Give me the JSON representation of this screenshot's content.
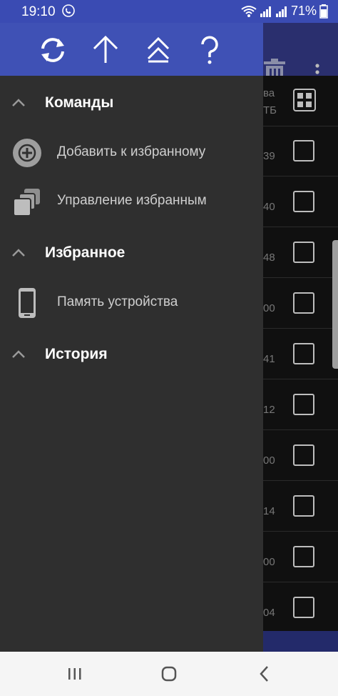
{
  "status_bar": {
    "time": "19:10",
    "battery": "71%",
    "icons": [
      "call-forward-icon",
      "wifi-icon",
      "signal-icon",
      "signal-icon",
      "battery-icon"
    ]
  },
  "drawer": {
    "header_buttons": [
      {
        "name": "refresh-icon"
      },
      {
        "name": "up-arrow-icon"
      },
      {
        "name": "collapse-all-icon"
      },
      {
        "name": "help-icon"
      }
    ],
    "sections": [
      {
        "title": "Команды",
        "items": [
          {
            "label": "Добавить к избранному",
            "icon": "add-circle-icon"
          },
          {
            "label": "Управление избранным",
            "icon": "copy-stack-icon"
          }
        ]
      },
      {
        "title": "Избранное",
        "items": [
          {
            "label": "Память устройства",
            "icon": "phone-icon"
          }
        ]
      },
      {
        "title": "История",
        "items": []
      }
    ]
  },
  "background_app": {
    "rows": [
      {
        "num_top": "ва",
        "num_bottom": "ТБ"
      },
      {
        "num": "39"
      },
      {
        "num": "40"
      },
      {
        "num": "48"
      },
      {
        "num": "00"
      },
      {
        "num": "41"
      },
      {
        "num": "12"
      },
      {
        "num": "00"
      },
      {
        "num": "14"
      },
      {
        "num": "00"
      },
      {
        "num": "04"
      }
    ]
  },
  "colors": {
    "header_blue": "#3f51b5",
    "drawer_bg": "#2f2f2f"
  }
}
